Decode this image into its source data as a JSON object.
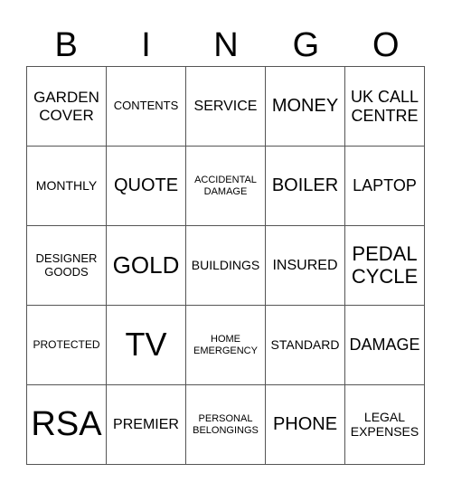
{
  "header": {
    "letters": [
      "B",
      "I",
      "N",
      "G",
      "O"
    ]
  },
  "grid": {
    "rows": [
      [
        "GARDEN COVER",
        "CONTENTS",
        "SERVICE",
        "MONEY",
        "UK CALL CENTRE"
      ],
      [
        "MONTHLY",
        "QUOTE",
        "ACCIDENTAL DAMAGE",
        "BOILER",
        "LAPTOP"
      ],
      [
        "DESIGNER GOODS",
        "GOLD",
        "BUILDINGS",
        "INSURED",
        "PEDAL CYCLE"
      ],
      [
        "PROTECTED",
        "TV",
        "HOME EMERGENCY",
        "STANDARD",
        "DAMAGE"
      ],
      [
        "RSA",
        "PREMIER",
        "PERSONAL BELONGINGS",
        "PHONE",
        "LEGAL EXPENSES"
      ]
    ]
  }
}
